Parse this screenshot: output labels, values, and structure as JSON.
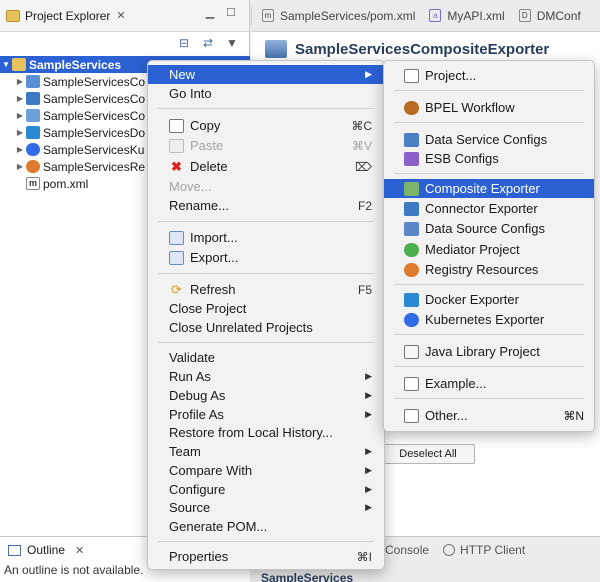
{
  "explorer": {
    "title": "Project Explorer",
    "close_glyph": "✕",
    "tree": [
      {
        "label": "SampleServices",
        "selected": true,
        "expanded": true
      },
      {
        "label": "SampleServicesCo",
        "icon": "composite-project-icon",
        "color": "#5b8fd6"
      },
      {
        "label": "SampleServicesCo",
        "icon": "connector-project-icon",
        "color": "#3c7bc4"
      },
      {
        "label": "SampleServicesCo",
        "icon": "config-project-icon",
        "color": "#6d9fd9"
      },
      {
        "label": "SampleServicesDo",
        "icon": "docker-project-icon",
        "color": "#2b8ad4"
      },
      {
        "label": "SampleServicesKu",
        "icon": "kubernetes-project-icon",
        "color": "#326ce5"
      },
      {
        "label": "SampleServicesRe",
        "icon": "registry-project-icon",
        "color": "#e07a2e"
      },
      {
        "label": "pom.xml",
        "icon": "maven-file-icon",
        "color": "#444"
      }
    ]
  },
  "editor": {
    "tabs": [
      "SampleServices/pom.xml",
      "MyAPI.xml",
      "DMConf"
    ],
    "title": "SampleServicesCompositeExporter",
    "deselect_label": "Deselect All"
  },
  "outline": {
    "title": "Outline",
    "message": "An outline is not available."
  },
  "console": {
    "tabs": [
      "Console",
      "HTTP Client"
    ],
    "subtitle": "SampleServices"
  },
  "context_menu": {
    "items": [
      {
        "label": "New",
        "submenu": true,
        "active": true
      },
      {
        "label": "Go Into"
      },
      {
        "label": "Copy",
        "icon": "copy-icon",
        "shortcut": "⌘C"
      },
      {
        "label": "Paste",
        "icon": "paste-icon",
        "shortcut": "⌘V",
        "disabled": true
      },
      {
        "label": "Delete",
        "icon": "delete-icon",
        "shortcut": "⌦"
      },
      {
        "label": "Move...",
        "disabled": true
      },
      {
        "label": "Rename...",
        "shortcut": "F2"
      },
      {
        "label": "Import...",
        "icon": "import-icon"
      },
      {
        "label": "Export...",
        "icon": "export-icon"
      },
      {
        "label": "Refresh",
        "icon": "refresh-icon",
        "shortcut": "F5"
      },
      {
        "label": "Close Project"
      },
      {
        "label": "Close Unrelated Projects"
      },
      {
        "label": "Validate"
      },
      {
        "label": "Run As",
        "submenu": true
      },
      {
        "label": "Debug As",
        "submenu": true
      },
      {
        "label": "Profile As",
        "submenu": true
      },
      {
        "label": "Restore from Local History..."
      },
      {
        "label": "Team",
        "submenu": true
      },
      {
        "label": "Compare With",
        "submenu": true
      },
      {
        "label": "Configure",
        "submenu": true
      },
      {
        "label": "Source",
        "submenu": true
      },
      {
        "label": "Generate POM..."
      },
      {
        "label": "Properties",
        "shortcut": "⌘I"
      }
    ]
  },
  "new_submenu": {
    "items": [
      {
        "label": "Project...",
        "icon": "project-icon"
      },
      {
        "label": "BPEL Workflow",
        "icon": "bpel-icon"
      },
      {
        "label": "Data Service Configs",
        "icon": "data-service-icon"
      },
      {
        "label": "ESB Configs",
        "icon": "esb-icon"
      },
      {
        "label": "Composite Exporter",
        "icon": "composite-exporter-icon",
        "active": true
      },
      {
        "label": "Connector Exporter",
        "icon": "connector-exporter-icon"
      },
      {
        "label": "Data Source Configs",
        "icon": "data-source-icon"
      },
      {
        "label": "Mediator Project",
        "icon": "mediator-icon"
      },
      {
        "label": "Registry Resources",
        "icon": "registry-icon"
      },
      {
        "label": "Docker Exporter",
        "icon": "docker-icon"
      },
      {
        "label": "Kubernetes Exporter",
        "icon": "kubernetes-icon"
      },
      {
        "label": "Java Library Project",
        "icon": "java-library-icon"
      },
      {
        "label": "Example...",
        "icon": "example-icon"
      },
      {
        "label": "Other...",
        "icon": "other-icon",
        "shortcut": "⌘N"
      }
    ]
  }
}
